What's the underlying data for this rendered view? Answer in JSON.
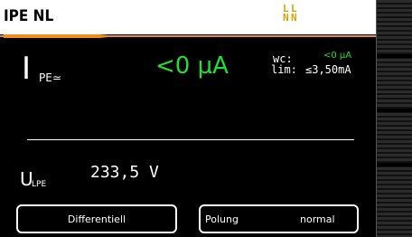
{
  "header": {
    "title": "IPE NL",
    "phase_glyphs": [
      "L",
      "L",
      "N",
      "N"
    ]
  },
  "measurement": {
    "symbol": "I",
    "subscript": "PE≃",
    "value": "<0 µA",
    "wc_label": "wc:",
    "wc_value": "<0 µA",
    "lim_label": "lim:",
    "lim_value": "≤3,50mA"
  },
  "voltage": {
    "symbol": "U",
    "subscript": "LPE",
    "value": "233,5 V"
  },
  "buttons": {
    "mode": "Differentiell",
    "polarity_label": "Polung",
    "polarity_value": "normal"
  },
  "colors": {
    "accent": "#f08c1e",
    "measure_green": "#22dd33",
    "phase_yellow": "#d9a400"
  }
}
